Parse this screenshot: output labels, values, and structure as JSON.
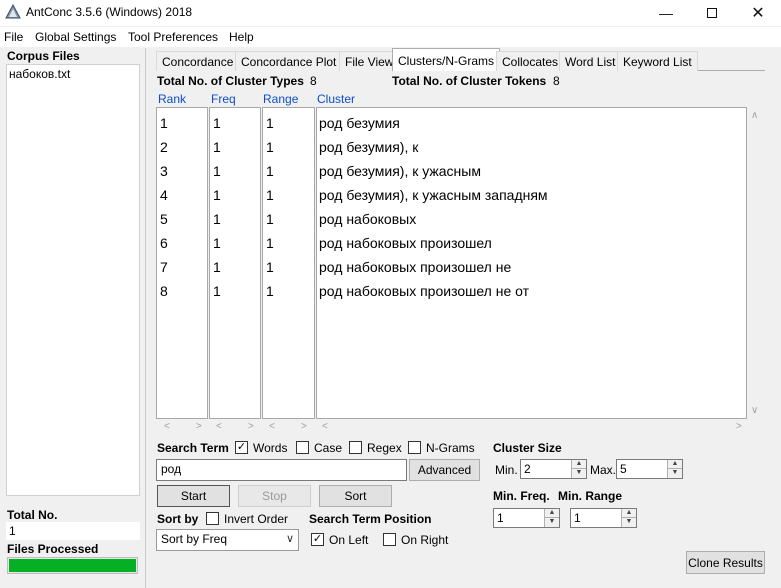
{
  "window": {
    "title": "AntConc 3.5.6 (Windows) 2018"
  },
  "menu": [
    "File",
    "Global Settings",
    "Tool Preferences",
    "Help"
  ],
  "sidebar": {
    "corpus_files_label": "Corpus Files",
    "files": [
      "набоков.txt"
    ],
    "total_no_label": "Total No.",
    "total_no_value": "1",
    "files_processed_label": "Files Processed",
    "progress_fraction": 1.0
  },
  "tabs": [
    "Concordance",
    "Concordance Plot",
    "File View",
    "Clusters/N-Grams",
    "Collocates",
    "Word List",
    "Keyword List"
  ],
  "active_tab": "Clusters/N-Grams",
  "summary": {
    "types_label": "Total No. of Cluster Types",
    "types_value": "8",
    "tokens_label": "Total No. of Cluster Tokens",
    "tokens_value": "8"
  },
  "table": {
    "headers": [
      "Rank",
      "Freq",
      "Range",
      "Cluster"
    ],
    "rows": [
      [
        "1",
        "1",
        "1",
        "род безумия"
      ],
      [
        "2",
        "1",
        "1",
        "род безумия), к"
      ],
      [
        "3",
        "1",
        "1",
        "род безумия), к ужасным"
      ],
      [
        "4",
        "1",
        "1",
        "род безумия), к ужасным западням"
      ],
      [
        "5",
        "1",
        "1",
        "род набоковых"
      ],
      [
        "6",
        "1",
        "1",
        "род набоковых произошел"
      ],
      [
        "7",
        "1",
        "1",
        "род набоковых произошел не"
      ],
      [
        "8",
        "1",
        "1",
        "род набоковых произошел не  от"
      ]
    ]
  },
  "search": {
    "term_label": "Search Term",
    "words_label": "Words",
    "words_checked": true,
    "case_label": "Case",
    "case_checked": false,
    "regex_label": "Regex",
    "regex_checked": false,
    "ngrams_label": "N-Grams",
    "ngrams_checked": false,
    "value": "род",
    "advanced_label": "Advanced",
    "start_label": "Start",
    "stop_label": "Stop",
    "sort_label": "Sort"
  },
  "sort": {
    "sort_by_label": "Sort by",
    "invert_label": "Invert Order",
    "invert_checked": false,
    "selected": "Sort by Freq"
  },
  "position": {
    "label": "Search Term Position",
    "on_left_label": "On Left",
    "on_left_checked": true,
    "on_right_label": "On Right",
    "on_right_checked": false
  },
  "cluster_size": {
    "label": "Cluster Size",
    "min_label": "Min.",
    "min_value": "2",
    "max_label": "Max.",
    "max_value": "5"
  },
  "min_freq": {
    "label": "Min. Freq.",
    "value": "1"
  },
  "min_range": {
    "label": "Min. Range",
    "value": "1"
  },
  "clone_label": "Clone Results",
  "colors": {
    "header_blue": "#0c4ec9",
    "progress_green": "#06b025"
  }
}
